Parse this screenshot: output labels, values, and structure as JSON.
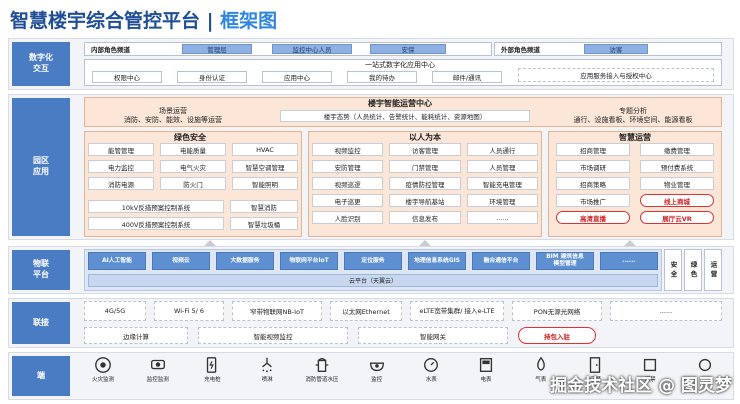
{
  "title": {
    "main": "智慧楼宇综合管控平台 | ",
    "accent": "框架图"
  },
  "layers": {
    "digital": "数字化\n交互",
    "park": "园区\n应用",
    "iot": "物联\n平台",
    "connect": "联接",
    "edge": "端"
  },
  "digital": {
    "internal_label": "内部角色频道",
    "internal_btns": [
      "管理层",
      "监控中心人员",
      "安保"
    ],
    "external_label": "外部角色频道",
    "external_btn": "访客",
    "portal_title": "一站式数字化应用中心",
    "portal_items": [
      "权限中心",
      "身份认证",
      "应用中心",
      "我的待办",
      "邮件/通讯"
    ],
    "portal_right": "应用服务接入与授权中心"
  },
  "ops": {
    "title": "楼宇智能运营中心",
    "left_title": "场景运营",
    "left_desc": "消防、安防、能效、设施等运营",
    "mid_desc": "楼宇态势（人员统计、告警统计、能耗统计、资源地图）",
    "right_title": "专题分析",
    "right_desc": "通行、设施看板、环境空间、能源看板"
  },
  "green": {
    "title": "绿色安全",
    "rows": [
      [
        "能管管理",
        "电能质量",
        "HVAC"
      ],
      [
        "电力监控",
        "电气火灾",
        "智慧空调管理"
      ],
      [
        "消防电源",
        "防火门",
        "智能照明"
      ]
    ],
    "wide_rows": [
      [
        "10kV反措预案控制系统",
        "智慧消防"
      ],
      [
        "400V反措预案控制系统",
        "智慧垃圾桶"
      ]
    ]
  },
  "people": {
    "title": "以人为本",
    "rows": [
      [
        "视频监控",
        "访客管理",
        "人员通行"
      ],
      [
        "安防管理",
        "门禁管理",
        "人员管理"
      ],
      [
        "视频巡逻",
        "疫情防控管理",
        "智能充电管理"
      ],
      [
        "电子巡更",
        "楼宇导航基站",
        "环境管理"
      ],
      [
        "人脸识别",
        "信息发布",
        "......"
      ]
    ]
  },
  "smart": {
    "title": "智慧运营",
    "rows": [
      [
        "招商管理",
        "缴费管理"
      ],
      [
        "市场调研",
        "预付费系统"
      ],
      [
        "招商策略",
        "物业管理"
      ]
    ],
    "row4_left": "市场推广",
    "row4_right_red": "线上商城",
    "red_left": "高清直播",
    "red_right": "展厅云VR"
  },
  "iot": {
    "buttons": [
      "AI人工智能",
      "视频云",
      "大数据服务",
      "物联网平台IoT",
      "定位服务",
      "地理信息系统GIS",
      "融合通信平台",
      "BIM 建筑信息\n模型管理",
      "......"
    ],
    "cloud": "云平台（天翼云）",
    "side": [
      "安全",
      "绿色",
      "运营"
    ]
  },
  "connect": {
    "row1": [
      "4G/5G",
      "Wi-Fi 5/ 6",
      "窄带物联网NB-IoT",
      "以太网Ethernet",
      "eLTE宽带集群/ 接入e-LTE",
      "PON无源光网络",
      "......"
    ],
    "row2": [
      "边缘计算",
      "智能视频监控",
      "智能网关",
      "持包入驻"
    ]
  },
  "devices": [
    {
      "icon": "fire-alarm-icon",
      "label": "火灾监测"
    },
    {
      "icon": "camera-icon",
      "label": "监控监测"
    },
    {
      "icon": "charging-pile-icon",
      "label": "充电桩"
    },
    {
      "icon": "sprinkler-icon",
      "label": "喷淋"
    },
    {
      "icon": "fire-hydrant-icon",
      "label": "消防管道水压"
    },
    {
      "icon": "dome-camera-icon",
      "label": "监控"
    },
    {
      "icon": "water-meter-icon",
      "label": "水表"
    },
    {
      "icon": "electric-meter-icon",
      "label": "电表"
    },
    {
      "icon": "gas-icon",
      "label": "气表"
    },
    {
      "icon": "door-icon",
      "label": "门禁"
    },
    {
      "icon": "more-icon",
      "label": "门禁"
    },
    {
      "icon": "more-icon",
      "label": "..."
    }
  ],
  "watermark": "掘金技术社区 @ 图灵梦"
}
